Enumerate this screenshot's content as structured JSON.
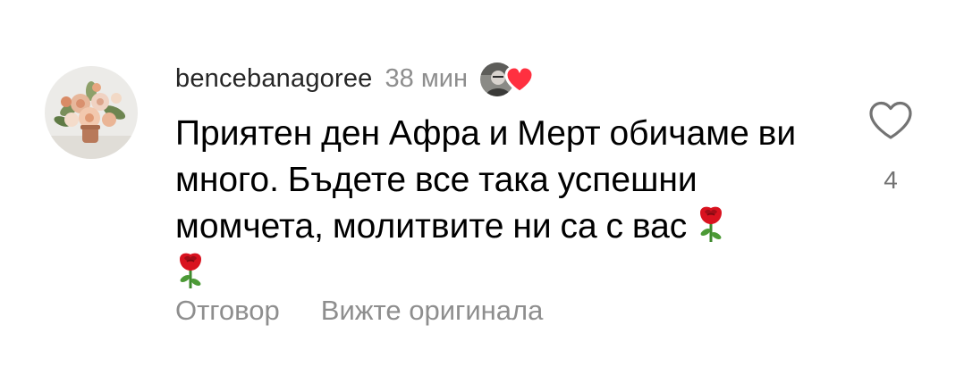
{
  "comment": {
    "username": "bencebanagoree",
    "timestamp": "38 мин",
    "text": "Приятен ден Афра и Мерт обичаме ви много. Бъдете все така успешни момчета, молитвите ни са с вас",
    "trailing_emoji": [
      "rose",
      "rose"
    ],
    "like_count": "4",
    "actions": {
      "reply": "Отговор",
      "see_original": "Вижте оригинала"
    }
  },
  "icons": {
    "avatar": "flower-bouquet-avatar",
    "liked_by_author": "author-avatar-with-heart",
    "like": "heart-outline-icon",
    "emoji": "rose-emoji"
  },
  "colors": {
    "username": "#262626",
    "secondary_text": "#8e8e8e",
    "heart_red": "#ff3040",
    "like_outline": "#737373"
  }
}
